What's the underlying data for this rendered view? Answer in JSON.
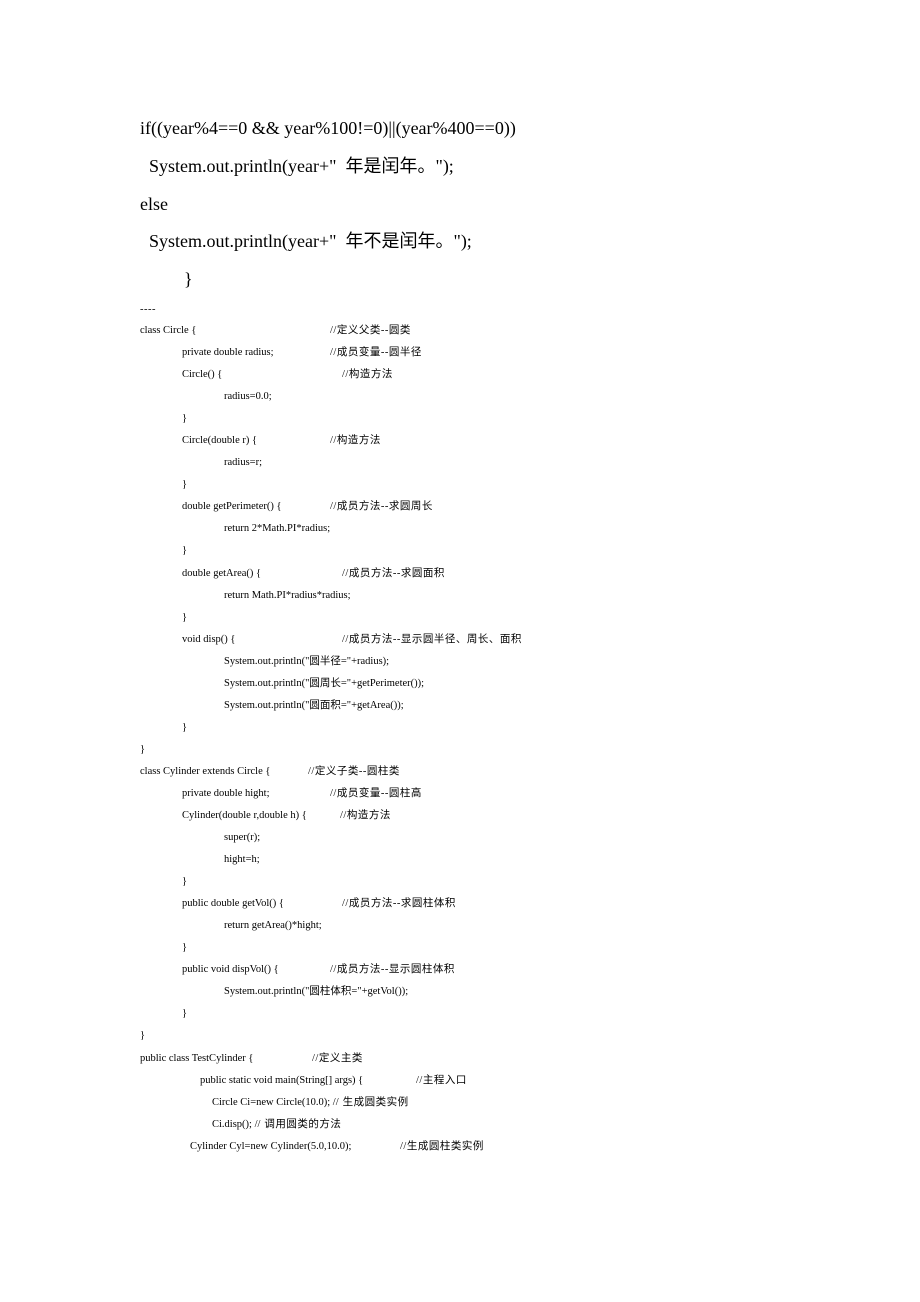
{
  "big": {
    "l1": "if((year%4==0 && year%100!=0)||(year%400==0))",
    "l2": "  System.out.println(year+\"  年是闰年。\");",
    "l3": "else",
    "l4": "  System.out.println(year+\"  年不是闰年。\");",
    "l5": "}"
  },
  "dashes": "----",
  "code": {
    "c01a": "class Circle {",
    "c01b": "//定义父类--圆类",
    "c02a": "private double radius;",
    "c02b": "//成员变量--圆半径",
    "c03a": "Circle() {",
    "c03b": "//构造方法",
    "c04": "radius=0.0;",
    "c05": "}",
    "c06a": "Circle(double r) {",
    "c06b": "//构造方法",
    "c07": "radius=r;",
    "c08": "}",
    "c09a": "double getPerimeter() {",
    "c09b": "//成员方法--求圆周长",
    "c10": "return 2*Math.PI*radius;",
    "c11": "}",
    "c12a": "double getArea() {",
    "c12b": "//成员方法--求圆面积",
    "c13": "return Math.PI*radius*radius;",
    "c14": "}",
    "c15a": "void disp() {",
    "c15b": "//成员方法--显示圆半径、周长、面积",
    "c16": "System.out.println(\"圆半径=\"+radius);",
    "c17": "System.out.println(\"圆周长=\"+getPerimeter());",
    "c18": "System.out.println(\"圆面积=\"+getArea());",
    "c19": "}",
    "c20": "}",
    "c21a": "class Cylinder extends Circle {",
    "c21b": "//定义子类--圆柱类",
    "c22a": "private double hight;",
    "c22b": "//成员变量--圆柱高",
    "c23a": "Cylinder(double r,double h) {",
    "c23b": "//构造方法",
    "c24": "super(r);",
    "c25": "hight=h;",
    "c26": "}",
    "c27a": "public double getVol() {",
    "c27b": "//成员方法--求圆柱体积",
    "c28": "return getArea()*hight;",
    "c29": "}",
    "c30a": "public void dispVol() {",
    "c30b": "//成员方法--显示圆柱体积",
    "c31": "System.out.println(\"圆柱体积=\"+getVol());",
    "c32": "}",
    "c33": "}",
    "c34a": "public class TestCylinder {",
    "c34b": "//定义主类",
    "c35a": "public static void main(String[] args) {",
    "c35b": "//主程入口",
    "c36a": "Circle Ci=new Circle(10.0); //",
    "c36b": "生成圆类实例",
    "c37a": "Ci.disp(); //",
    "c37b": "调用圆类的方法",
    "c38a": "Cylinder Cyl=new Cylinder(5.0,10.0);",
    "c38b": "//生成圆柱类实例"
  }
}
